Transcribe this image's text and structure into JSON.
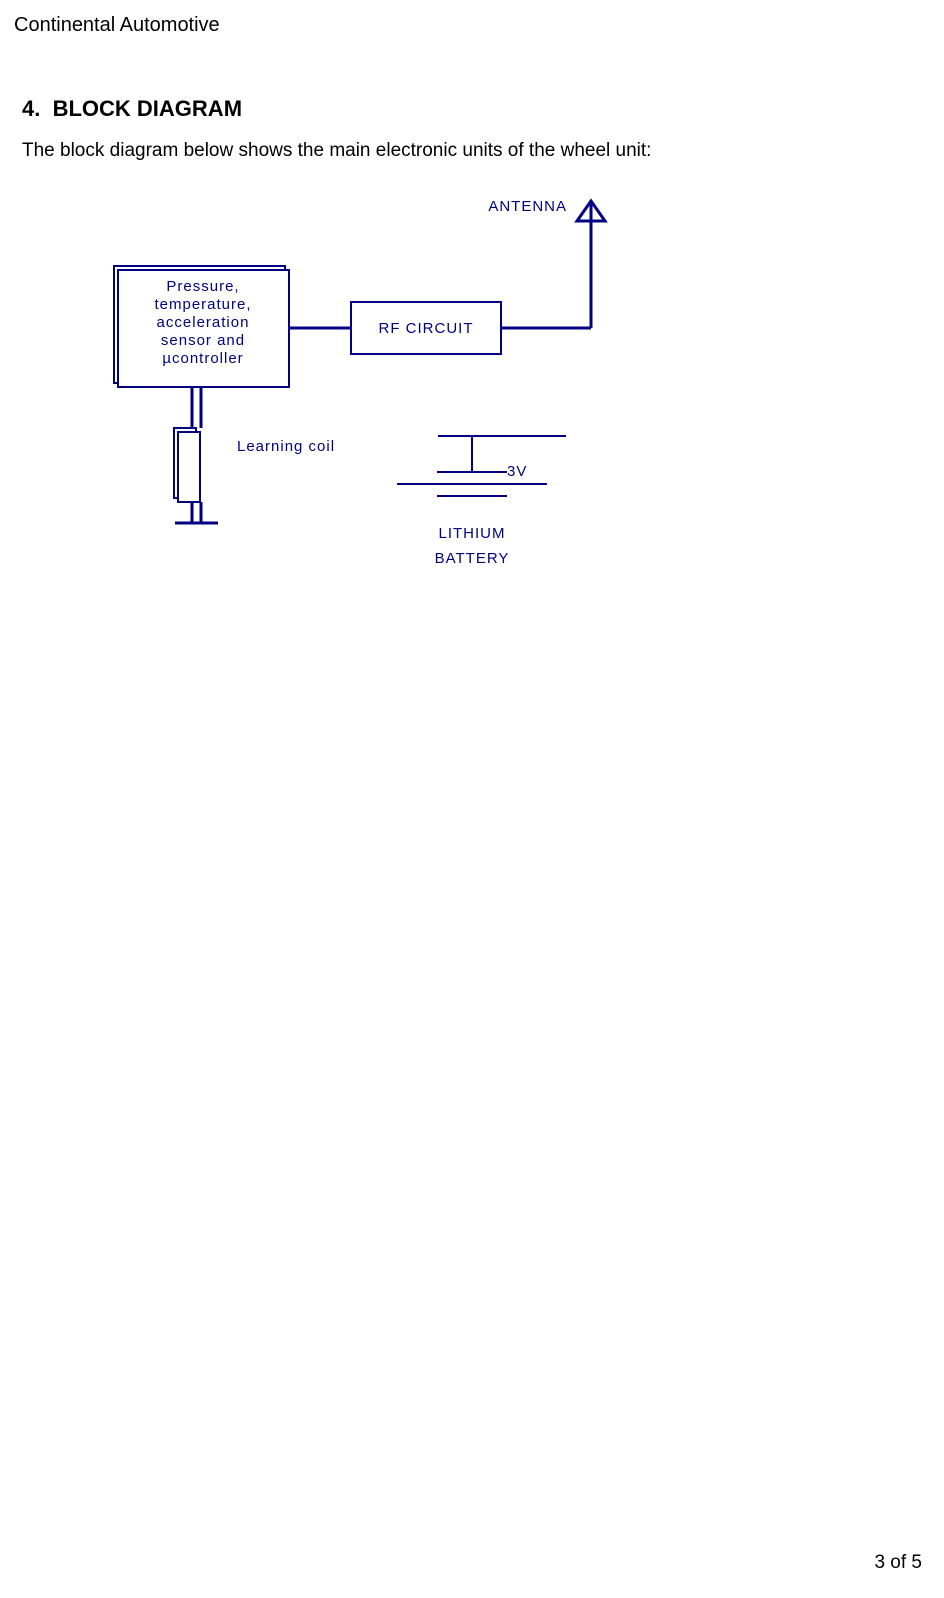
{
  "document_header": "Continental Automotive",
  "section": {
    "number": "4.",
    "title": "BLOCK DIAGRAM"
  },
  "intro_text": "The block diagram below shows the main electronic units of the wheel unit:",
  "diagram": {
    "sensor_block": {
      "line1": "Pressure,",
      "line2": "temperature,",
      "line3": "acceleration",
      "line4": "sensor and",
      "line5": "µcontroller"
    },
    "rf_block": "RF CIRCUIT",
    "antenna_label": "ANTENNA",
    "coil_label": "Learning coil",
    "battery_voltage": "3V",
    "battery_label_line1": "LITHIUM",
    "battery_label_line2": "BATTERY"
  },
  "footer": "3 of 5"
}
